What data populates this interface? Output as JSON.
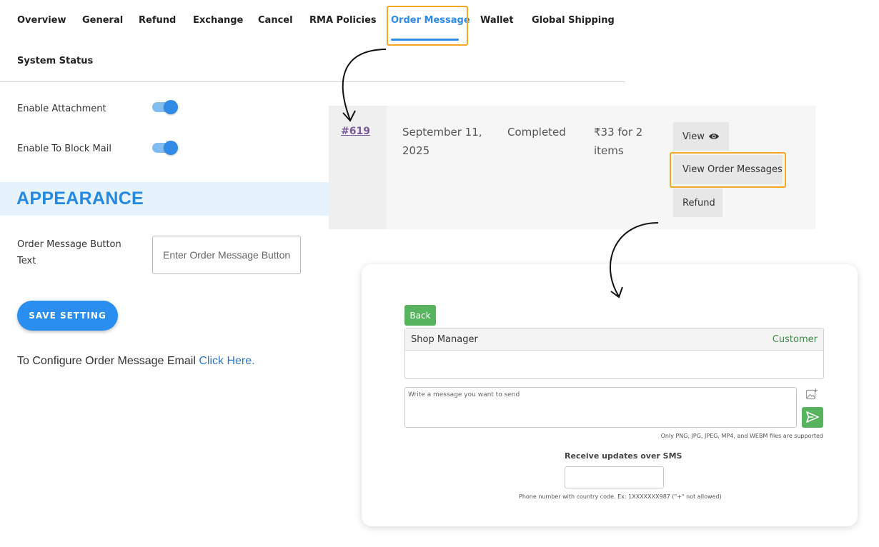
{
  "tabs": [
    {
      "label": "Overview"
    },
    {
      "label": "General"
    },
    {
      "label": "Refund"
    },
    {
      "label": "Exchange"
    },
    {
      "label": "Cancel"
    },
    {
      "label": "RMA Policies"
    },
    {
      "label": "Order Message",
      "active": true
    },
    {
      "label": "Wallet"
    },
    {
      "label": "Global Shipping"
    },
    {
      "label": "System Status"
    }
  ],
  "settings": {
    "enable_attachment": {
      "label": "Enable Attachment",
      "enabled": true
    },
    "enable_block_mail": {
      "label": "Enable To Block Mail",
      "enabled": true
    }
  },
  "appearance": {
    "title": "APPEARANCE",
    "button_text_label": "Order Message Button Text",
    "button_text_placeholder": "Enter Order Message Button...",
    "button_text_value": ""
  },
  "save_button": "SAVE SETTING",
  "config": {
    "text": "To Configure Order Message Email",
    "link": "Click Here."
  },
  "order_row": {
    "number": "#619",
    "date_line1": "September 11,",
    "date_line2": "2025",
    "status": "Completed",
    "total_line1": "₹33 for 2",
    "total_line2": "items",
    "actions": {
      "view": "View",
      "view_messages": "View Order Messages",
      "refund": "Refund"
    }
  },
  "messages": {
    "back": "Back",
    "left_party": "Shop Manager",
    "right_party": "Customer",
    "input_placeholder": "Write a message you want to send",
    "supported_note": "Only PNG, JPG, JPEG, MP4, and WEBM files are supported",
    "sms_label": "Receive updates over SMS",
    "sms_value": "",
    "sms_note": "Phone number with country code. Ex: 1XXXXXXX987 (\"+\" not allowed)"
  },
  "colors": {
    "accent": "#2f8be6",
    "highlight": "#f5a623",
    "green": "#58b35f"
  },
  "icons": {
    "view": "eye-icon",
    "attach": "image-add-icon",
    "send": "send-icon"
  }
}
